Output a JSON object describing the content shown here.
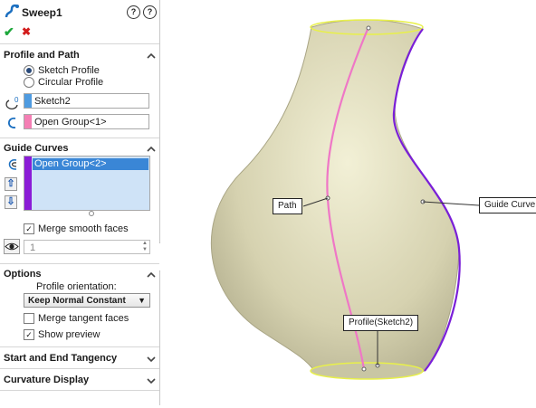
{
  "title": "Sweep1",
  "help_icons": [
    "?",
    "?"
  ],
  "actions": {
    "ok": "✔",
    "cancel": "✖"
  },
  "sections": {
    "profile_and_path": {
      "header": "Profile and Path",
      "options": [
        {
          "label": "Sketch Profile",
          "selected": true
        },
        {
          "label": "Circular Profile",
          "selected": false
        }
      ],
      "profile_field": "Sketch2",
      "path_field": "Open Group<1>"
    },
    "guide_curves": {
      "header": "Guide Curves",
      "list": [
        "Open Group<2>"
      ],
      "merge_smooth_faces": "Merge smooth faces",
      "spinner_value": "1"
    },
    "options": {
      "header": "Options",
      "profile_orientation_label": "Profile orientation:",
      "profile_orientation_value": "Keep Normal Constant",
      "merge_tangent_faces": "Merge tangent faces",
      "show_preview": "Show preview"
    },
    "start_end": {
      "header": "Start and End Tangency"
    },
    "curvature": {
      "header": "Curvature Display"
    }
  },
  "callouts": {
    "path": "Path",
    "guide_curve": "Guide Curve",
    "profile": "Profile(Sketch2)"
  },
  "colors": {
    "profile_swatch": "#4f9be0",
    "path_swatch": "#f47fb4",
    "guide_swatch": "#8a1cd6",
    "vase_fill": "#d9d5b6",
    "guide_curve": "#7a1fd8",
    "path_curve": "#ef77c6",
    "rim": "#e8f04a"
  }
}
